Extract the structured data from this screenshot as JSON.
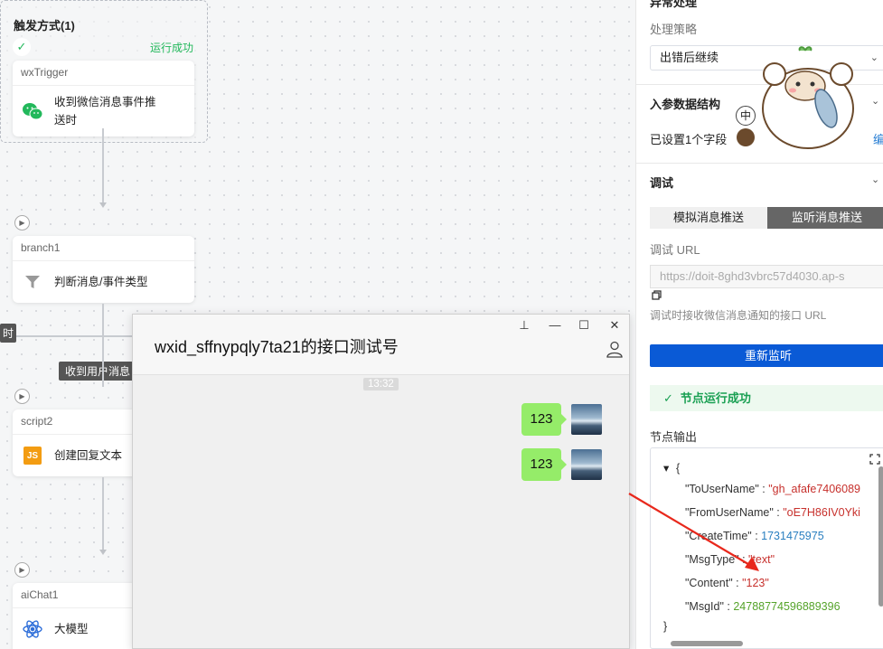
{
  "canvas": {
    "trigger_section_title": "触发方式(1)",
    "trigger_status": "运行成功",
    "nodes": [
      {
        "id": "wxTrigger",
        "label": "收到微信消息事件推送时"
      },
      {
        "id": "branch1",
        "label": "判断消息/事件类型"
      },
      {
        "id": "script2",
        "label": "创建回复文本"
      },
      {
        "id": "aiChat1",
        "label": "大模型"
      }
    ],
    "branch_tag": "收到用户消息",
    "left_edge_tag": "时",
    "check_glyph": "✓",
    "js_glyph": "JS"
  },
  "chat_window": {
    "title": "wxid_sffnypqly7ta21的接口测试号",
    "time": "13:32",
    "messages": [
      "123",
      "123"
    ],
    "controls": {
      "pin": "⊥",
      "minimize": "—",
      "maximize": "☐",
      "close": "✕"
    }
  },
  "panel": {
    "top_header_partial": "异常处理",
    "strategy_label": "处理策略",
    "strategy_value": "出错后继续",
    "input_struct_title": "入参数据结构",
    "fields_set": "已设置1个字段",
    "edit_link_partial": "编",
    "debug_title": "调试",
    "tabs": [
      "模拟消息推送",
      "监听消息推送"
    ],
    "debug_url_label": "调试 URL",
    "debug_url_value": "https://doit-8ghd3vbrc57d4030.ap-s",
    "debug_url_hint": "调试时接收微信消息通知的接口 URL",
    "relisten_button": "重新监听",
    "node_success": "节点运行成功",
    "node_output_label": "节点输出",
    "zh_badge": "中",
    "output": {
      "open_brace": "{",
      "close_brace": "}",
      "entries": [
        {
          "key": "\"ToUserName\"",
          "value": "\"gh_afafe7406089"
        },
        {
          "key": "\"FromUserName\"",
          "value": "\"oE7H86IV0Yki"
        },
        {
          "key": "\"CreateTime\"",
          "value": "1731475975"
        },
        {
          "key": "\"MsgType\"",
          "value": "\"text\""
        },
        {
          "key": "\"Content\"",
          "value": "\"123\""
        },
        {
          "key": "\"MsgId\"",
          "value": "24788774596889396"
        }
      ]
    }
  },
  "colors": {
    "success_green": "#22b85b",
    "primary_blue": "#0a5ad6",
    "wechat_bubble": "#95ec69",
    "annotation_red": "#e8281c"
  }
}
